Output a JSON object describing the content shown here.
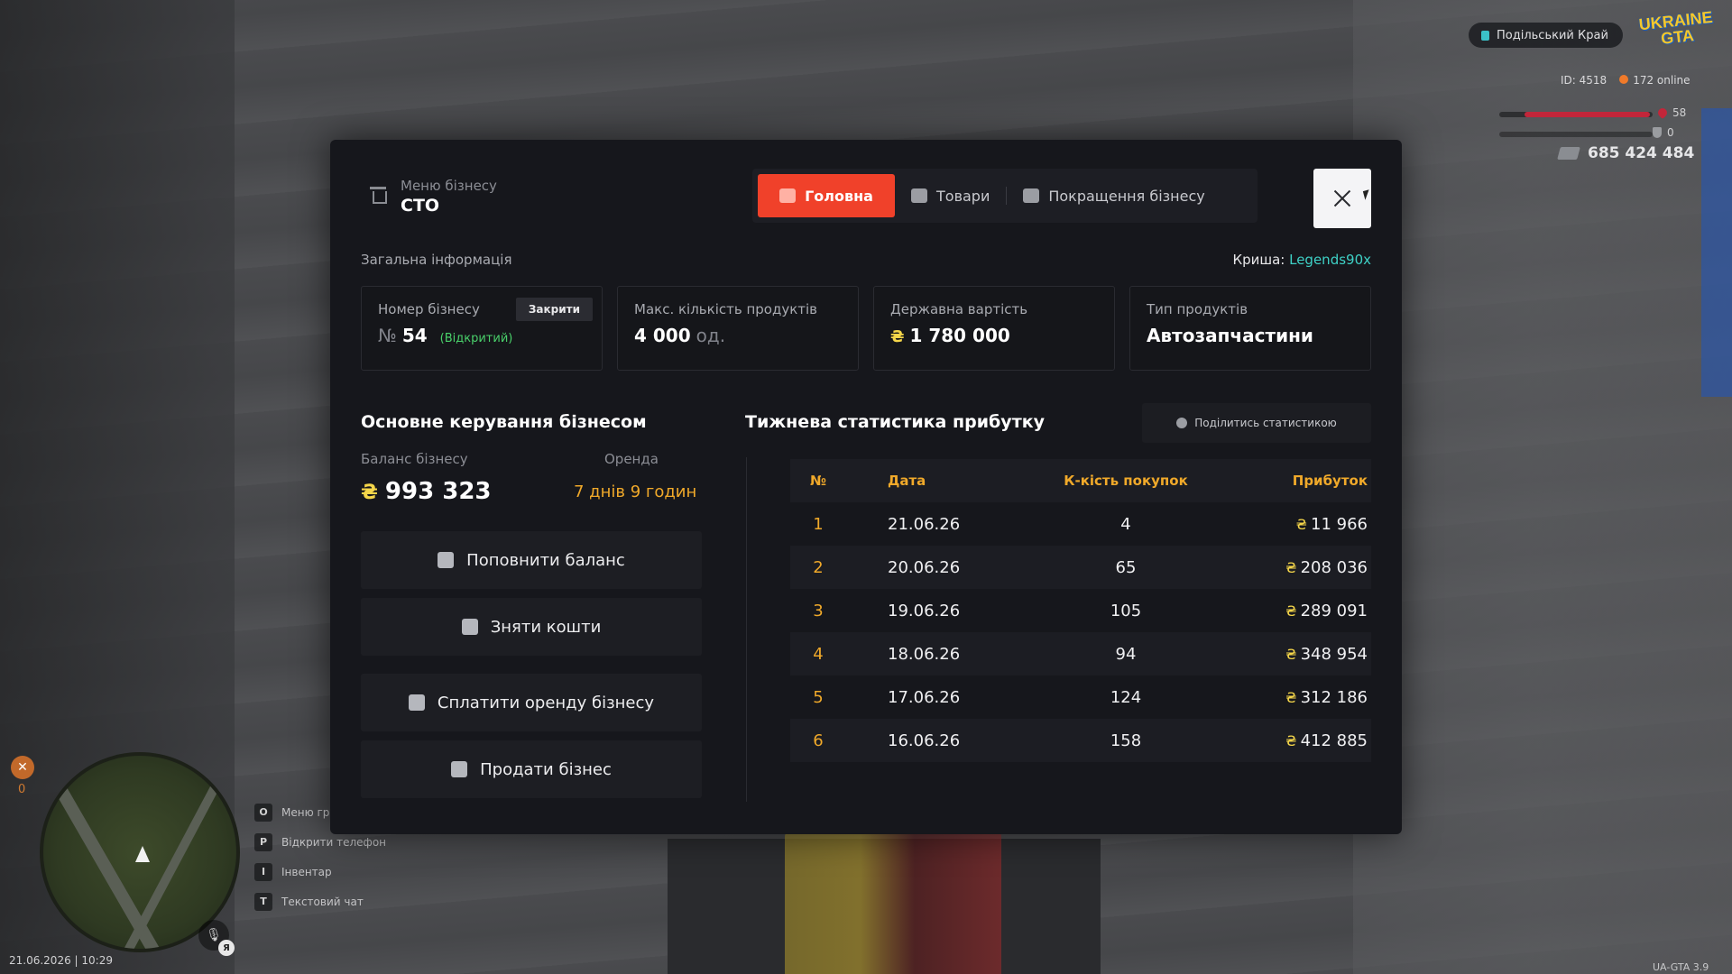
{
  "hud": {
    "server": "Подільський Край",
    "logo_text": "UKRAINE GTA",
    "player_id": "ID: 4518",
    "online": "172 online",
    "health": "58",
    "health_percent": 58,
    "armor": "0",
    "money": "685 424 484",
    "wrench_count": "0",
    "lang": "Я",
    "datetime": "21.06.2026 | 10:29",
    "version": "UA-GTA 3.9",
    "hints": [
      {
        "key": "O",
        "label": "Меню гр"
      },
      {
        "key": "P",
        "label": "Відкрити телефон"
      },
      {
        "key": "I",
        "label": "Інвентар"
      },
      {
        "key": "T",
        "label": "Текстовий чат"
      }
    ]
  },
  "header": {
    "subtitle": "Меню бізнесу",
    "title": "СТО"
  },
  "tabs": [
    {
      "label": "Головна",
      "icon": "home-icon",
      "active": true
    },
    {
      "label": "Товари",
      "icon": "basket-icon",
      "active": false
    },
    {
      "label": "Покращення бізнесу",
      "icon": "wallet-icon",
      "active": false
    }
  ],
  "general": {
    "title": "Загальна інформація",
    "roof_label": "Криша:",
    "roof_value": "Legends90x"
  },
  "cards": {
    "number": {
      "label": "Номер бізнесу",
      "prefix": "№",
      "value": "54",
      "status": "(Відкритий)",
      "close_label": "Закрити"
    },
    "max_products": {
      "label": "Макс. кількість продуктів",
      "value": "4 000",
      "unit": "од."
    },
    "state_value": {
      "label": "Державна вартість",
      "currency": "₴",
      "value": "1 780 000"
    },
    "product_type": {
      "label": "Тип продуктів",
      "value": "Автозапчастини"
    }
  },
  "management": {
    "title": "Основне керування бізнесом",
    "balance_label": "Баланс бізнесу",
    "balance_currency": "₴",
    "balance_value": "993 323",
    "rent_label": "Оренда",
    "rent_value": "7 днів 9 годин",
    "actions": [
      {
        "label": "Поповнити баланс",
        "icon": "deposit-icon"
      },
      {
        "label": "Зняти кошти",
        "icon": "withdraw-icon"
      },
      {
        "label": "Сплатити оренду бізнесу",
        "icon": "users-icon"
      },
      {
        "label": "Продати бізнес",
        "icon": "bank-icon"
      }
    ]
  },
  "stats": {
    "title": "Тижнева статистика прибутку",
    "share_label": "Поділитись статистикою",
    "columns": [
      "№",
      "Дата",
      "К-кість покупок",
      "Прибуток"
    ],
    "currency": "₴",
    "rows": [
      {
        "no": "1",
        "date": "21.06.26",
        "count": "4",
        "profit": "11 966"
      },
      {
        "no": "2",
        "date": "20.06.26",
        "count": "65",
        "profit": "208 036"
      },
      {
        "no": "3",
        "date": "19.06.26",
        "count": "105",
        "profit": "289 091"
      },
      {
        "no": "4",
        "date": "18.06.26",
        "count": "94",
        "profit": "348 954"
      },
      {
        "no": "5",
        "date": "17.06.26",
        "count": "124",
        "profit": "312 186"
      },
      {
        "no": "6",
        "date": "16.06.26",
        "count": "158",
        "profit": "412 885"
      }
    ]
  }
}
